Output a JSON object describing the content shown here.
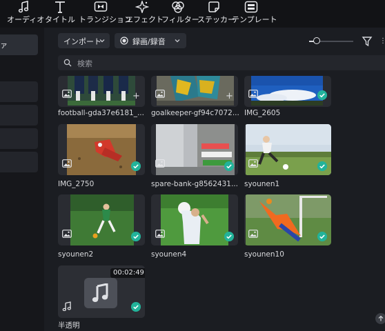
{
  "toolbar": {
    "items": [
      {
        "label": "オーディオ",
        "icon": "music-note-icon"
      },
      {
        "label": "タイトル",
        "icon": "title-t-icon"
      },
      {
        "label": "トランジション",
        "icon": "transition-icon"
      },
      {
        "label": "エフェクト",
        "icon": "effect-sparkle-icon"
      },
      {
        "label": "フィルター",
        "icon": "filter-icon"
      },
      {
        "label": "ステッカー",
        "icon": "sticker-icon"
      },
      {
        "label": "テンプレート",
        "icon": "template-icon"
      }
    ]
  },
  "sidebar": {
    "items": [
      {
        "label": "ァ"
      },
      {
        "label": ""
      },
      {
        "label": ""
      },
      {
        "label": ""
      },
      {
        "label": ""
      }
    ]
  },
  "controls": {
    "import_label": "インポート",
    "record_label": "録画/録音"
  },
  "search": {
    "placeholder": "検索"
  },
  "media": [
    {
      "name": "football-gda37e6181_...",
      "type": "image",
      "imported": false
    },
    {
      "name": "goalkeeper-gf94c7072...",
      "type": "image",
      "imported": false
    },
    {
      "name": "IMG_2605",
      "type": "image",
      "imported": true
    },
    {
      "name": "IMG_2750",
      "type": "image",
      "imported": true
    },
    {
      "name": "spare-bank-g8562431...",
      "type": "image",
      "imported": true
    },
    {
      "name": "syounen1",
      "type": "image",
      "imported": true
    },
    {
      "name": "syounen2",
      "type": "image",
      "imported": true
    },
    {
      "name": "syounen4",
      "type": "image",
      "imported": true
    },
    {
      "name": "syounen10",
      "type": "image",
      "imported": true
    },
    {
      "name": "半透明",
      "type": "audio",
      "imported": true,
      "duration": "00:02:49"
    }
  ],
  "colors": {
    "accent": "#22b39a",
    "background": "#1b1d22",
    "toolbar": "#121316"
  }
}
